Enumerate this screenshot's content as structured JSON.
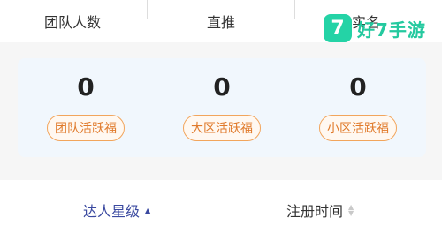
{
  "stats": {
    "labels": [
      "团队人数",
      "直推",
      "实名"
    ]
  },
  "watermark": {
    "badge": "7",
    "text": "好7手游"
  },
  "welfare": [
    {
      "value": "0",
      "label": "团队活跃福"
    },
    {
      "value": "0",
      "label": "大区活跃福"
    },
    {
      "value": "0",
      "label": "小区活跃福"
    }
  ],
  "sort": {
    "primary_label": "达人星级",
    "secondary_label": "注册时间"
  },
  "colors": {
    "accent_blue": "#3a49a0",
    "pill_orange": "#e07a2b",
    "card_bg": "#f1f7fd",
    "watermark_green": "#24c99f"
  },
  "icons": {
    "sort_primary": "sort-asc-icon",
    "sort_secondary": "sort-icon"
  }
}
